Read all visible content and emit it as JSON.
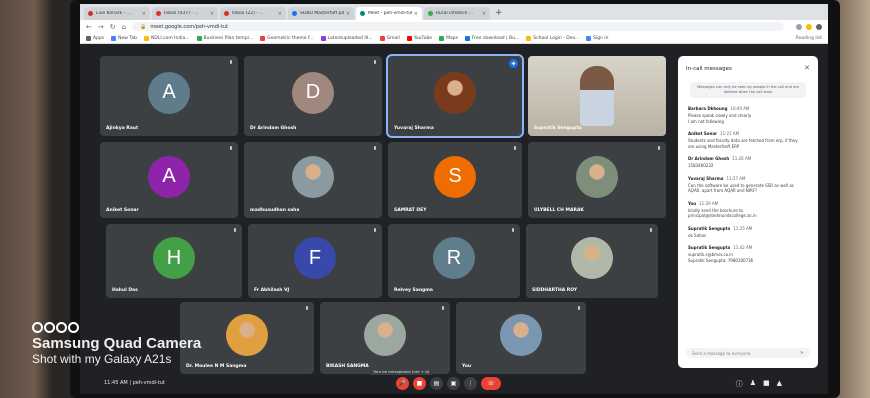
{
  "browser": {
    "tabs": [
      {
        "label": "Live Konark - ...",
        "favicon_color": "#cc3333",
        "active": false
      },
      {
        "label": "Inbox (437) - ...",
        "favicon_color": "#d93025",
        "active": false
      },
      {
        "label": "Inbox (22) - ...",
        "favicon_color": "#d93025",
        "active": false
      },
      {
        "label": "SOBO Masterfuff.pdf",
        "favicon_color": "#1a73e8",
        "active": false
      },
      {
        "label": "Meet - peh-vmdi-tut",
        "favicon_color": "#00897b",
        "active": true
      },
      {
        "label": "Rural infotech ...",
        "favicon_color": "#34a853",
        "active": false
      }
    ],
    "url": "meet.google.com/peh-vmdi-tut",
    "bookmarks": [
      {
        "label": "Apps",
        "color": "#5f6368"
      },
      {
        "label": "New Tab",
        "color": "#4285f4"
      },
      {
        "label": "NDLI.com India...",
        "color": "#fbbc04"
      },
      {
        "label": "Business Plan templ...",
        "color": "#34a853"
      },
      {
        "label": "Geometric theme f...",
        "color": "#ea4335"
      },
      {
        "label": "Latentuploaded III...",
        "color": "#9334e6"
      },
      {
        "label": "Gmail",
        "color": "#ea4335"
      },
      {
        "label": "YouTube",
        "color": "#ff0000"
      },
      {
        "label": "Maps",
        "color": "#34a853"
      },
      {
        "label": "Free download | Bu...",
        "color": "#1a73e8"
      },
      {
        "label": "School Login - Dev...",
        "color": "#fbbc04"
      },
      {
        "label": "Sign in",
        "color": "#4285f4"
      }
    ],
    "other_bookmarks": "Reading list"
  },
  "participants": [
    {
      "name": "Ajinkya Raut",
      "initial": "A",
      "color": "#5f7c8a",
      "kind": "avatar"
    },
    {
      "name": "Dr Arindam Ghosh",
      "initial": "D",
      "color": "#a1887f",
      "kind": "avatar"
    },
    {
      "name": "Yuvaraj Sharma",
      "initial": "",
      "color": "#7a3b1c",
      "kind": "photo"
    },
    {
      "name": "Supratik Sengupta",
      "initial": "",
      "color": "#c8c4b8",
      "kind": "video"
    },
    {
      "name": "Aniket Sonar",
      "initial": "A",
      "color": "#8e24aa",
      "kind": "avatar"
    },
    {
      "name": "madhusudhan saha",
      "initial": "",
      "color": "#8a9aa0",
      "kind": "photo"
    },
    {
      "name": "SAMRAT DEY",
      "initial": "S",
      "color": "#ef6c00",
      "kind": "avatar"
    },
    {
      "name": "ULYBELL CH MARAK",
      "initial": "",
      "color": "#7d8f7a",
      "kind": "photo"
    },
    {
      "name": "Hahul Das",
      "initial": "H",
      "color": "#43a047",
      "kind": "avatar"
    },
    {
      "name": "Fr Abhilash VJ",
      "initial": "F",
      "color": "#3949ab",
      "kind": "avatar"
    },
    {
      "name": "Relvey Sangma",
      "initial": "R",
      "color": "#607d8b",
      "kind": "avatar"
    },
    {
      "name": "SIDDHARTHA ROY",
      "initial": "",
      "color": "#b0b8a8",
      "kind": "photo"
    },
    {
      "name": "Dr. Moulee N M Sangma",
      "initial": "",
      "color": "#e0a040",
      "kind": "photo"
    },
    {
      "name": "BIKASH SANGMA",
      "initial": "",
      "color": "#9aa8a0",
      "kind": "photo"
    },
    {
      "name": "You",
      "initial": "",
      "color": "#7a96b0",
      "kind": "photo"
    }
  ],
  "chat": {
    "title": "In-call messages",
    "note": "Messages can only be seen by people in the call and are deleted when the call ends",
    "messages": [
      {
        "sender": "Barbara Dkhoung",
        "time": "10:40 AM",
        "lines": [
          "Please speak slowly and clearly",
          "I am not following"
        ]
      },
      {
        "sender": "Aniket Sonar",
        "time": "11:21 AM",
        "lines": [
          "Students and faculty data are fetched from erp, if they",
          "are using Masterfsoft ERP"
        ]
      },
      {
        "sender": "Dr Arindam Ghosh",
        "time": "11:26 AM",
        "lines": [
          "1583460232"
        ]
      },
      {
        "sender": "Yuvaraj Sharma",
        "time": "11:27 AM",
        "lines": [
          "Can the software be used to generate SSR as well as",
          "AQAR, apart from AQAR and NIRF?"
        ]
      },
      {
        "sender": "You",
        "time": "11:29 AM",
        "lines": [
          "kindly send the brochure to",
          "principal@stedmundscollege.ac.in"
        ]
      },
      {
        "sender": "Supratik Sengupta",
        "time": "11:35 AM",
        "lines": [
          "ok Sahas"
        ]
      },
      {
        "sender": "Supratik Sengupta",
        "time": "11:42 AM",
        "lines": [
          "supratik.s@bmsv.co.in",
          "Supratik Sengupta: 7980100736"
        ]
      }
    ],
    "input_placeholder": "Send a message to everyone"
  },
  "bottom": {
    "time_and_code": "11:45 AM  |  peh-vmdi-tut",
    "mic_tooltip": "Turn on microphone (ctrl + d)"
  },
  "watermark": {
    "line1": "Samsung Quad Camera",
    "line2": "Shot with my Galaxy A21s"
  }
}
